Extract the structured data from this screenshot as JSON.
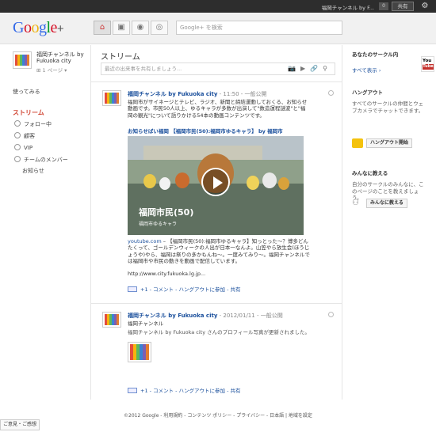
{
  "topbar": {
    "user_name": "福岡チャンネル by F...",
    "notif_count": "0",
    "share_label": "共有",
    "gear": "gear-icon"
  },
  "header": {
    "logo": "Google+",
    "search_placeholder": "Google+ を検索",
    "nav_icons": [
      "home-icon",
      "photos-icon",
      "profile-icon",
      "circles-icon"
    ]
  },
  "left": {
    "profile_name": "福岡チャンネル by Fukuoka city",
    "profile_page": "1 ページ",
    "try_label": "使ってみる",
    "stream_label": "ストリーム",
    "circles": [
      "フォロー中",
      "顧客",
      "VIP",
      "チームのメンバー",
      "お知らせ"
    ]
  },
  "center": {
    "title": "ストリーム",
    "share_placeholder": "最近の出来事を共有しましょう...",
    "post1": {
      "author": "福岡チャンネル by Fukuoka city",
      "meta": " - 11:50 - 一般公開",
      "text": "福岡市がサイネージとテレビ、ラジオ、新聞と締結運動しておくる、お知らせ動画です。市民50人以上、ゆるキャラが多数が出演して\"数造運程謎波\"と\"福岡の観光\"について語りかける54本の動画コンテンツです。",
      "link_title": "お知らせばい福岡 【福岡市民(50):福岡市ゆるキャラ】 by 福岡市",
      "video_caption": "福岡市民(50)",
      "video_sub": "福岡市ゆるキャラ",
      "source": "youtube.com",
      "desc": " – 【福岡市民(50):福岡市ゆるキャラ】知っとった〜？博多どんたくって、ゴールデンウィークの人出が日本一なんよ。山笠やら放生会(ほうじょうや)やら、福岡は祭りの多かもんね〜。一度みてみり〜。福岡チャンネルでは福岡市や市民の動きを動画で配信しています。",
      "url": "http://www.city.fukuoka.lg.jp...",
      "actions": "+1 - コメント - ハングアウトに参加 - 共有"
    },
    "post2": {
      "author": "福岡チャンネル by Fukuoka city",
      "meta": " - 2012/01/11 - 一般公開",
      "line1": "福岡チャンネル",
      "line2": "福岡チャンネル by Fukuoka city さんのプロフィール写真が更新されました。",
      "actions": "+1 - コメント - ハングアウトに参加 - 共有"
    }
  },
  "right": {
    "circles_head": "あなたのサークル内",
    "show_all": "すべて表示 ›",
    "youtube_label": "You Tube",
    "hangout_head": "ハングアウト",
    "hangout_text": "すべてのサークルの仲間とウェブカメラでチャットできます。",
    "hangout_button": "ハングアウト開始",
    "tell_head": "みんなに教える",
    "tell_text": "自分のサークルのみんなに、このページのことを教えましょう。",
    "tell_button": "みんなに教える"
  },
  "footer": {
    "text": "©2012 Google - 利用規約 - コンテンツ ポリシー - プライバシー - 日本語 | 地域を設定",
    "feedback": "ご意見・ご感想"
  },
  "colors": {
    "accent_red": "#d14836",
    "link_blue": "#1a4f9c",
    "topbar": "#2d2d2d"
  }
}
